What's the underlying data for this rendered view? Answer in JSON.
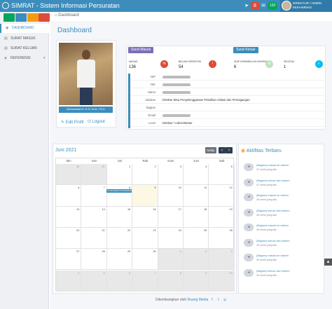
{
  "app": {
    "title": "SIMRAT - Sistem Informasi Persuratan"
  },
  "topbar": {
    "notif_count": "8",
    "msg_count": "133",
    "user_line1": "DIREKTUR / ADMIN",
    "user_line2": "MUHAMMAD"
  },
  "sidebar": {
    "items": [
      {
        "label": "DASHBOARD"
      },
      {
        "label": "SURAT MASUK"
      },
      {
        "label": "SURAT KELUAR"
      },
      {
        "label": "REFERENSI"
      }
    ]
  },
  "breadcrumb": "Dashboard",
  "page_title": "Dashboard",
  "profile": {
    "name": "Muhammad M. S.Si, M.M., Ph.D",
    "edit_label": "Edit Profil",
    "logout_label": "Logout"
  },
  "stats": {
    "incoming_tag": "Surat Masuk",
    "outgoing_tag": "Surat Keluar",
    "items": [
      {
        "label": "MASUK",
        "value": "136"
      },
      {
        "label": "BELUM DIRESPON",
        "value": "54"
      },
      {
        "label": "SIAP KIRIM/BELUM DIKIRIM",
        "value": "6"
      },
      {
        "label": "SELESAI",
        "value": "1"
      }
    ]
  },
  "info": {
    "rows": [
      {
        "key": "NIP",
        "value": ""
      },
      {
        "key": "NIK",
        "value": ""
      },
      {
        "key": "Nama",
        "value": ""
      },
      {
        "key": "Jabatan",
        "value": "Direktur Bina Penyelenggaraan Pelatihan Vokasi dan Pemagangan"
      },
      {
        "key": "Bagian",
        "value": ""
      },
      {
        "key": "Email",
        "value": ""
      },
      {
        "key": "Level",
        "value": "Direktur / Administrator"
      }
    ]
  },
  "calendar": {
    "title": "Juni 2021",
    "today_label": "today",
    "prev_label": "‹",
    "next_label": "›",
    "days": [
      "Min",
      "Sen",
      "Sel",
      "Rab",
      "Kam",
      "Jum",
      "Sab"
    ],
    "weeks": [
      [
        "30",
        "31",
        "1",
        "2",
        "3",
        "4",
        "5"
      ],
      [
        "6",
        "7",
        "8",
        "9",
        "10",
        "11",
        "12"
      ],
      [
        "13",
        "14",
        "15",
        "16",
        "17",
        "18",
        "19"
      ],
      [
        "20",
        "21",
        "22",
        "23",
        "24",
        "25",
        "26"
      ],
      [
        "27",
        "28",
        "29",
        "30",
        "1",
        "2",
        "3"
      ],
      [
        "4",
        "5",
        "6",
        "7",
        "8",
        "9",
        "10"
      ]
    ],
    "event": "12:00 RAPAT KOORDINASI"
  },
  "activity": {
    "title": "Aktifitas Terbaru",
    "items": [
      {
        "text": "(Bagian) masuk ke sistem",
        "time": "47 menit yang lalu"
      },
      {
        "text": "(Bagian) keluar dari sistem",
        "time": "47 menit yang lalu"
      },
      {
        "text": "(Bagian) masuk ke sistem",
        "time": "48 menit yang lalu"
      },
      {
        "text": "(Bagian) keluar dari sistem",
        "time": "48 menit yang lalu"
      },
      {
        "text": "(Bagian) masuk ke sistem",
        "time": "48 menit yang lalu"
      },
      {
        "text": "(Bagian) keluar dari sistem",
        "time": "49 menit yang lalu"
      },
      {
        "text": "(Bagian) masuk ke sistem",
        "time": "49 menit yang lalu"
      },
      {
        "text": "(Bagian) keluar dari sistem",
        "time": "49 menit yang lalu"
      }
    ]
  },
  "footer": {
    "text": "Dikembangkan oleh",
    "brand": "Ruang Media"
  }
}
